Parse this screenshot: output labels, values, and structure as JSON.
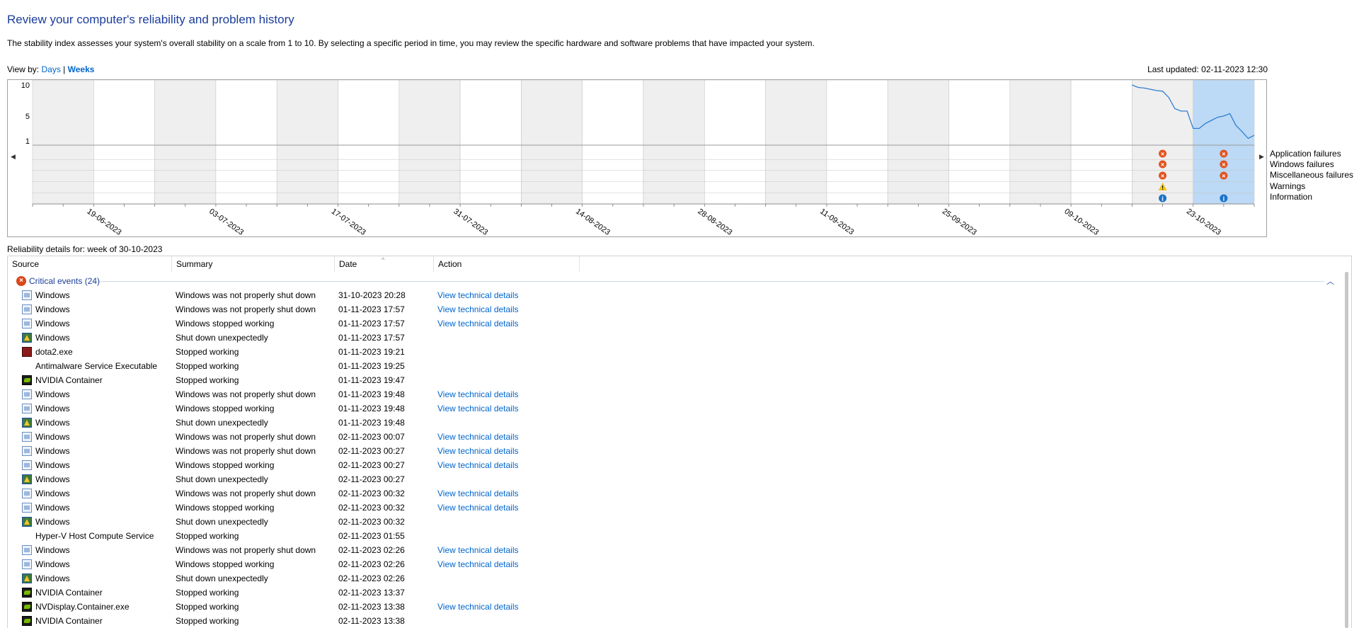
{
  "page": {
    "title": "Review your computer's reliability and problem history",
    "description": "The stability index assesses your system's overall stability on a scale from 1 to 10. By selecting a specific period in time, you may review the specific hardware and software problems that have impacted your system.",
    "view_by_label": "View by:",
    "view_days": "Days",
    "view_separator": "|",
    "view_weeks": "Weeks",
    "last_updated": "Last updated: 02-11-2023 12:30"
  },
  "chart": {
    "y_ticks": [
      "10",
      "5",
      "1"
    ],
    "date_labels": [
      "19-06-2023",
      "03-07-2023",
      "17-07-2023",
      "31-07-2023",
      "14-08-2023",
      "28-08-2023",
      "11-09-2023",
      "25-09-2023",
      "09-10-2023",
      "23-10-2023"
    ],
    "row_labels": [
      "Application failures",
      "Windows failures",
      "Miscellaneous failures",
      "Warnings",
      "Information"
    ],
    "selected_week_index": 19,
    "colors": {
      "alt_column": "#efefef",
      "selected": "#bcd9f5",
      "line": "#2f7fd1",
      "error": "#e1531f",
      "warning": "#f3c21a",
      "info": "#1a73c9"
    }
  },
  "chart_data": {
    "type": "line",
    "ylim": [
      1,
      10
    ],
    "x": [
      "19-06-2023",
      "03-07-2023",
      "17-07-2023",
      "31-07-2023",
      "14-08-2023",
      "28-08-2023",
      "11-09-2023",
      "25-09-2023",
      "09-10-2023",
      "23-10-2023"
    ],
    "series": [
      {
        "values": [
          10,
          9.6,
          9.5,
          9.3,
          9.1,
          9.0,
          8.0,
          6.2,
          5.8,
          5.8,
          3.0,
          3.0,
          3.8,
          4.3,
          4.8,
          5.0,
          5.4,
          3.5,
          2.5,
          1.4,
          1.9
        ]
      }
    ],
    "events": [
      {
        "week_index": 18,
        "rows": [
          "error",
          "error",
          "error",
          "warning",
          "info"
        ]
      },
      {
        "week_index": 19,
        "rows": [
          "error",
          "error",
          "error",
          "",
          "info"
        ]
      }
    ]
  },
  "details": {
    "label": "Reliability details for: week of 30-10-2023",
    "columns": {
      "source": "Source",
      "summary": "Summary",
      "date": "Date",
      "action": "Action"
    },
    "group_label": "Critical events (24)",
    "group_icon": "error-icon",
    "collapse_icon": "chevron-up-icon",
    "rows": [
      {
        "icon": "win",
        "source": "Windows",
        "summary": "Windows was not properly shut down",
        "date": "31-10-2023 20:28",
        "action": "View technical details"
      },
      {
        "icon": "win",
        "source": "Windows",
        "summary": "Windows was not properly shut down",
        "date": "01-11-2023 17:57",
        "action": "View technical details"
      },
      {
        "icon": "win",
        "source": "Windows",
        "summary": "Windows stopped working",
        "date": "01-11-2023 17:57",
        "action": "View technical details"
      },
      {
        "icon": "shut",
        "source": "Windows",
        "summary": "Shut down unexpectedly",
        "date": "01-11-2023 17:57",
        "action": ""
      },
      {
        "icon": "dota",
        "source": "dota2.exe",
        "summary": "Stopped working",
        "date": "01-11-2023 19:21",
        "action": ""
      },
      {
        "icon": "none",
        "source": "Antimalware Service Executable",
        "summary": "Stopped working",
        "date": "01-11-2023 19:25",
        "action": ""
      },
      {
        "icon": "nv",
        "source": "NVIDIA Container",
        "summary": "Stopped working",
        "date": "01-11-2023 19:47",
        "action": ""
      },
      {
        "icon": "win",
        "source": "Windows",
        "summary": "Windows was not properly shut down",
        "date": "01-11-2023 19:48",
        "action": "View technical details"
      },
      {
        "icon": "win",
        "source": "Windows",
        "summary": "Windows stopped working",
        "date": "01-11-2023 19:48",
        "action": "View technical details"
      },
      {
        "icon": "shut",
        "source": "Windows",
        "summary": "Shut down unexpectedly",
        "date": "01-11-2023 19:48",
        "action": ""
      },
      {
        "icon": "win",
        "source": "Windows",
        "summary": "Windows was not properly shut down",
        "date": "02-11-2023 00:07",
        "action": "View technical details"
      },
      {
        "icon": "win",
        "source": "Windows",
        "summary": "Windows was not properly shut down",
        "date": "02-11-2023 00:27",
        "action": "View technical details"
      },
      {
        "icon": "win",
        "source": "Windows",
        "summary": "Windows stopped working",
        "date": "02-11-2023 00:27",
        "action": "View technical details"
      },
      {
        "icon": "shut",
        "source": "Windows",
        "summary": "Shut down unexpectedly",
        "date": "02-11-2023 00:27",
        "action": ""
      },
      {
        "icon": "win",
        "source": "Windows",
        "summary": "Windows was not properly shut down",
        "date": "02-11-2023 00:32",
        "action": "View technical details"
      },
      {
        "icon": "win",
        "source": "Windows",
        "summary": "Windows stopped working",
        "date": "02-11-2023 00:32",
        "action": "View technical details"
      },
      {
        "icon": "shut",
        "source": "Windows",
        "summary": "Shut down unexpectedly",
        "date": "02-11-2023 00:32",
        "action": ""
      },
      {
        "icon": "none",
        "source": "Hyper-V Host Compute Service",
        "summary": "Stopped working",
        "date": "02-11-2023 01:55",
        "action": ""
      },
      {
        "icon": "win",
        "source": "Windows",
        "summary": "Windows was not properly shut down",
        "date": "02-11-2023 02:26",
        "action": "View technical details"
      },
      {
        "icon": "win",
        "source": "Windows",
        "summary": "Windows stopped working",
        "date": "02-11-2023 02:26",
        "action": "View technical details"
      },
      {
        "icon": "shut",
        "source": "Windows",
        "summary": "Shut down unexpectedly",
        "date": "02-11-2023 02:26",
        "action": ""
      },
      {
        "icon": "nv",
        "source": "NVIDIA Container",
        "summary": "Stopped working",
        "date": "02-11-2023 13:37",
        "action": ""
      },
      {
        "icon": "nv",
        "source": "NVDisplay.Container.exe",
        "summary": "Stopped working",
        "date": "02-11-2023 13:38",
        "action": "View technical details"
      },
      {
        "icon": "nv",
        "source": "NVIDIA Container",
        "summary": "Stopped working",
        "date": "02-11-2023 13:38",
        "action": ""
      }
    ]
  }
}
